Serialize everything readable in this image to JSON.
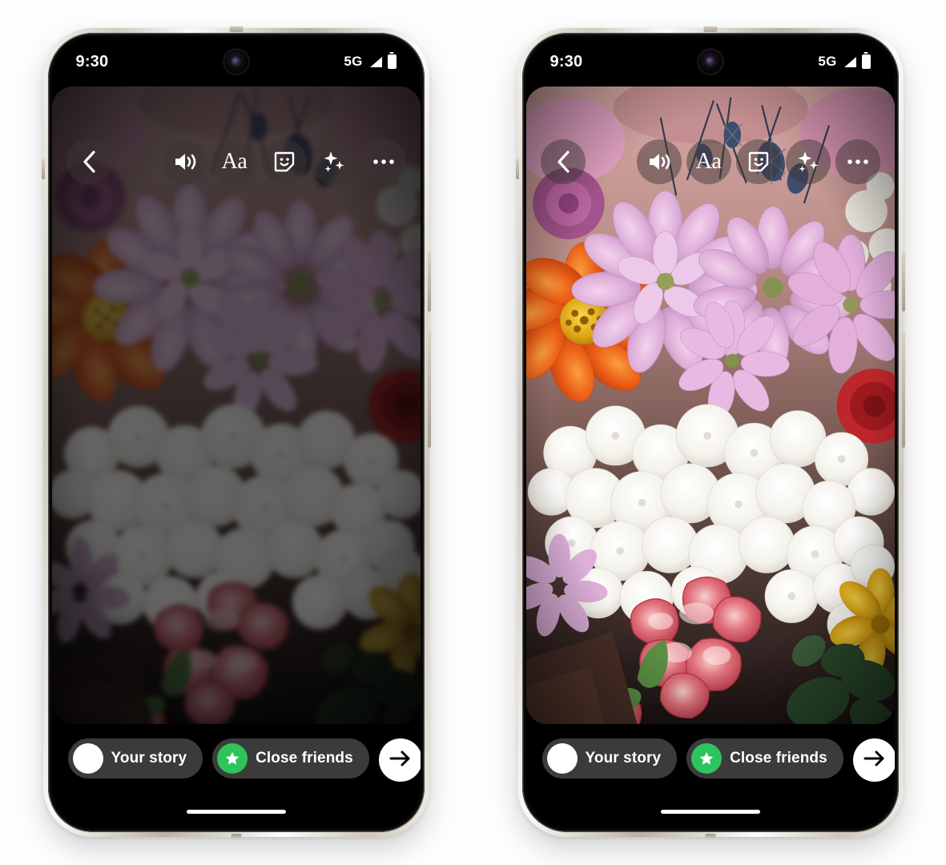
{
  "page": {
    "background_color": "#fdfdfd",
    "description": "Two phone mockups side by side showing an Instagram story sharing screen; left phone screen is dimmed/blurred, right phone screen is bright and sharp."
  },
  "phones": [
    {
      "id": "left-phone",
      "variant": "dimmed",
      "frame_color": "#cfc9bf",
      "status_bar": {
        "time": "9:30",
        "network": "5G",
        "signal_icon": "signal-bars-icon",
        "battery_icon": "battery-full-icon",
        "camera_icon": "front-camera-punchhole"
      },
      "toolbar": {
        "back_icon": "chevron-left-icon",
        "items": [
          {
            "icon": "volume-on-icon",
            "label": "Sound"
          },
          {
            "icon": "text-aa-icon",
            "label": "Aa"
          },
          {
            "icon": "sticker-smiley-icon",
            "label": "Sticker"
          },
          {
            "icon": "sparkles-effects-icon",
            "label": "Effects"
          },
          {
            "icon": "more-dots-icon",
            "label": "More"
          }
        ]
      },
      "bottom_bar": {
        "your_story_label": "Your story",
        "your_story_icon": "user-avatar",
        "close_friends_label": "Close friends",
        "close_friends_icon": "green-star-icon",
        "close_friends_color": "#2ec45c",
        "next_icon": "arrow-right-icon",
        "home_indicator": true
      }
    },
    {
      "id": "right-phone",
      "variant": "bright",
      "frame_color": "#cfc9bf",
      "status_bar": {
        "time": "9:30",
        "network": "5G",
        "signal_icon": "signal-bars-icon",
        "battery_icon": "battery-full-icon",
        "camera_icon": "front-camera-punchhole"
      },
      "toolbar": {
        "back_icon": "chevron-left-icon",
        "items": [
          {
            "icon": "volume-on-icon",
            "label": "Sound"
          },
          {
            "icon": "text-aa-icon",
            "label": "Aa"
          },
          {
            "icon": "sticker-smiley-icon",
            "label": "Sticker"
          },
          {
            "icon": "sparkles-effects-icon",
            "label": "Effects"
          },
          {
            "icon": "more-dots-icon",
            "label": "More"
          }
        ]
      },
      "bottom_bar": {
        "your_story_label": "Your story",
        "your_story_icon": "user-avatar",
        "close_friends_label": "Close friends",
        "close_friends_icon": "green-star-icon",
        "close_friends_color": "#2ec45c",
        "next_icon": "arrow-right-icon",
        "home_indicator": true
      }
    }
  ],
  "photo": {
    "subject": "Flower bouquet",
    "contents": [
      "pink lilac chrysanthemums",
      "orange zinnia",
      "white hydrangeas",
      "red-edged carnations",
      "yellow flower",
      "blue thistle",
      "green foliage"
    ],
    "palette": {
      "lilac": "#d9a8d4",
      "pink": "#e7b6d8",
      "orange": "#ea5c18",
      "yellow": "#e8b41b",
      "white_petal": "#f3f1ec",
      "carnation_red": "#c43a4a",
      "carnation_pink": "#e8909b",
      "thistle_blue": "#3f4c6b",
      "leaf_green": "#3c5a33",
      "backdrop": "#b48585"
    }
  }
}
